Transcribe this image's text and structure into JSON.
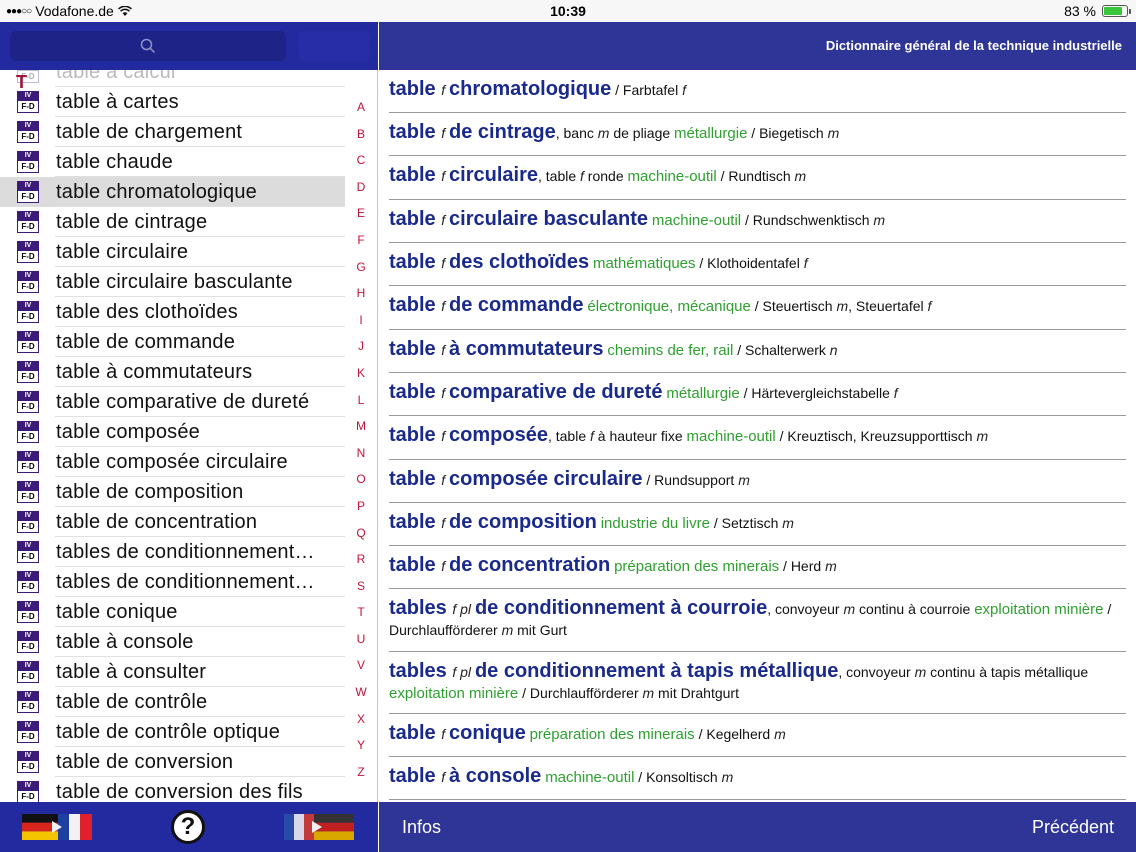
{
  "status": {
    "carrier": "Vodafone.de",
    "signal_dots": "●●●○○",
    "time": "10:39",
    "battery": "83 %",
    "battery_level": 0.83
  },
  "left": {
    "section_letter": "T",
    "search_icon": "magnifier-icon",
    "list": [
      {
        "label": "table à calcul",
        "faded": true
      },
      {
        "label": "table à cartes"
      },
      {
        "label": "table de chargement"
      },
      {
        "label": "table chaude"
      },
      {
        "label": "table chromatologique",
        "selected": true
      },
      {
        "label": "table de cintrage"
      },
      {
        "label": "table circulaire"
      },
      {
        "label": "table circulaire basculante"
      },
      {
        "label": "table des clothoïdes"
      },
      {
        "label": "table de commande"
      },
      {
        "label": "table à commutateurs"
      },
      {
        "label": "table comparative de dureté"
      },
      {
        "label": "table composée"
      },
      {
        "label": "table composée circulaire"
      },
      {
        "label": "table de composition"
      },
      {
        "label": "table de concentration"
      },
      {
        "label": "tables de conditionnement…"
      },
      {
        "label": "tables de conditionnement…"
      },
      {
        "label": "table conique"
      },
      {
        "label": "table à console"
      },
      {
        "label": "table à consulter"
      },
      {
        "label": "table de contrôle"
      },
      {
        "label": "table de contrôle optique"
      },
      {
        "label": "table de conversion"
      },
      {
        "label": "table de conversion des fils"
      }
    ],
    "icon_top": "IV",
    "icon_bottom": "F-D",
    "index": [
      "A",
      "B",
      "C",
      "D",
      "E",
      "F",
      "G",
      "H",
      "I",
      "J",
      "K",
      "L",
      "M",
      "N",
      "O",
      "P",
      "Q",
      "R",
      "S",
      "T",
      "U",
      "V",
      "W",
      "X",
      "Y",
      "Z"
    ],
    "footer": {
      "help": "?"
    }
  },
  "right": {
    "title": "Dictionnaire général de la technique industrielle",
    "footer": {
      "infos": "Infos",
      "previous": "Précédent"
    },
    "entries": [
      [
        [
          "hw",
          "table "
        ],
        [
          "gram",
          "f "
        ],
        [
          "hw",
          "chromatologique"
        ],
        [
          "t",
          " / Farbtafel "
        ],
        [
          "gram",
          "f"
        ]
      ],
      [
        [
          "hw",
          "table "
        ],
        [
          "gram",
          "f "
        ],
        [
          "hw",
          "de cintrage"
        ],
        [
          "t",
          ", banc "
        ],
        [
          "gram",
          "m"
        ],
        [
          "t",
          " de pliage "
        ],
        [
          "dom",
          "métallurgie"
        ],
        [
          "t",
          " / Biegetisch "
        ],
        [
          "gram",
          "m"
        ]
      ],
      [
        [
          "hw",
          "table "
        ],
        [
          "gram",
          "f "
        ],
        [
          "hw",
          "circulaire"
        ],
        [
          "t",
          ", table "
        ],
        [
          "gram",
          "f"
        ],
        [
          "t",
          " ronde "
        ],
        [
          "dom",
          "machine-outil"
        ],
        [
          "t",
          " / Rundtisch "
        ],
        [
          "gram",
          "m"
        ]
      ],
      [
        [
          "hw",
          "table "
        ],
        [
          "gram",
          "f "
        ],
        [
          "hw",
          "circulaire basculante"
        ],
        [
          "t",
          " "
        ],
        [
          "dom",
          "machine-outil"
        ],
        [
          "t",
          " / Rundschwenktisch "
        ],
        [
          "gram",
          "m"
        ]
      ],
      [
        [
          "hw",
          "table "
        ],
        [
          "gram",
          "f "
        ],
        [
          "hw",
          "des clothoïdes"
        ],
        [
          "t",
          " "
        ],
        [
          "dom",
          "mathématiques"
        ],
        [
          "t",
          " / Klothoidentafel "
        ],
        [
          "gram",
          "f"
        ]
      ],
      [
        [
          "hw",
          "table "
        ],
        [
          "gram",
          "f "
        ],
        [
          "hw",
          "de commande"
        ],
        [
          "t",
          " "
        ],
        [
          "dom",
          "électronique, mécanique"
        ],
        [
          "t",
          " / Steuertisch "
        ],
        [
          "gram",
          "m"
        ],
        [
          "t",
          ", Steuertafel "
        ],
        [
          "gram",
          "f"
        ]
      ],
      [
        [
          "hw",
          "table "
        ],
        [
          "gram",
          "f "
        ],
        [
          "hw",
          "à commutateurs"
        ],
        [
          "t",
          " "
        ],
        [
          "dom",
          "chemins de fer, rail"
        ],
        [
          "t",
          " / Schalterwerk "
        ],
        [
          "gram",
          "n"
        ]
      ],
      [
        [
          "hw",
          "table "
        ],
        [
          "gram",
          "f "
        ],
        [
          "hw",
          "comparative de dureté"
        ],
        [
          "t",
          " "
        ],
        [
          "dom",
          "métallurgie"
        ],
        [
          "t",
          " / Härtevergleichstabelle "
        ],
        [
          "gram",
          "f"
        ]
      ],
      [
        [
          "hw",
          "table "
        ],
        [
          "gram",
          "f "
        ],
        [
          "hw",
          "composée"
        ],
        [
          "t",
          ", table "
        ],
        [
          "gram",
          "f"
        ],
        [
          "t",
          " à hauteur fixe "
        ],
        [
          "dom",
          "machine-outil"
        ],
        [
          "t",
          " / Kreuztisch, Kreuzsupporttisch "
        ],
        [
          "gram",
          "m"
        ]
      ],
      [
        [
          "hw",
          "table "
        ],
        [
          "gram",
          "f "
        ],
        [
          "hw",
          "composée circulaire"
        ],
        [
          "t",
          " / Rundsupport "
        ],
        [
          "gram",
          "m"
        ]
      ],
      [
        [
          "hw",
          "table "
        ],
        [
          "gram",
          "f "
        ],
        [
          "hw",
          "de composition"
        ],
        [
          "t",
          " "
        ],
        [
          "dom",
          "industrie du livre"
        ],
        [
          "t",
          " / Setztisch "
        ],
        [
          "gram",
          "m"
        ]
      ],
      [
        [
          "hw",
          "table "
        ],
        [
          "gram",
          "f "
        ],
        [
          "hw",
          "de concentration"
        ],
        [
          "t",
          " "
        ],
        [
          "dom",
          "préparation des minerais"
        ],
        [
          "t",
          " / Herd "
        ],
        [
          "gram",
          "m"
        ]
      ],
      [
        [
          "hw",
          "tables "
        ],
        [
          "gram",
          "f pl "
        ],
        [
          "hw",
          "de conditionnement à courroie"
        ],
        [
          "t",
          ", convoyeur "
        ],
        [
          "gram",
          "m"
        ],
        [
          "t",
          " continu à courroie "
        ],
        [
          "dom",
          "exploitation minière"
        ],
        [
          "t",
          " / Durchlaufförderer "
        ],
        [
          "gram",
          "m"
        ],
        [
          "t",
          " mit Gurt"
        ]
      ],
      [
        [
          "hw",
          "tables "
        ],
        [
          "gram",
          "f pl "
        ],
        [
          "hw",
          "de conditionnement à tapis métallique"
        ],
        [
          "t",
          ", convoyeur "
        ],
        [
          "gram",
          "m"
        ],
        [
          "t",
          " continu à tapis métallique "
        ],
        [
          "dom",
          "exploitation minière"
        ],
        [
          "t",
          " / Durchlaufförderer "
        ],
        [
          "gram",
          "m"
        ],
        [
          "t",
          " mit Drahtgurt"
        ]
      ],
      [
        [
          "hw",
          "table "
        ],
        [
          "gram",
          "f "
        ],
        [
          "hw",
          "conique"
        ],
        [
          "t",
          " "
        ],
        [
          "dom",
          "préparation des minerais"
        ],
        [
          "t",
          " / Kegelherd "
        ],
        [
          "gram",
          "m"
        ]
      ],
      [
        [
          "hw",
          "table "
        ],
        [
          "gram",
          "f "
        ],
        [
          "hw",
          "à console"
        ],
        [
          "t",
          " "
        ],
        [
          "dom",
          "machine-outil"
        ],
        [
          "t",
          " / Konsoltisch "
        ],
        [
          "gram",
          "m"
        ]
      ]
    ]
  }
}
